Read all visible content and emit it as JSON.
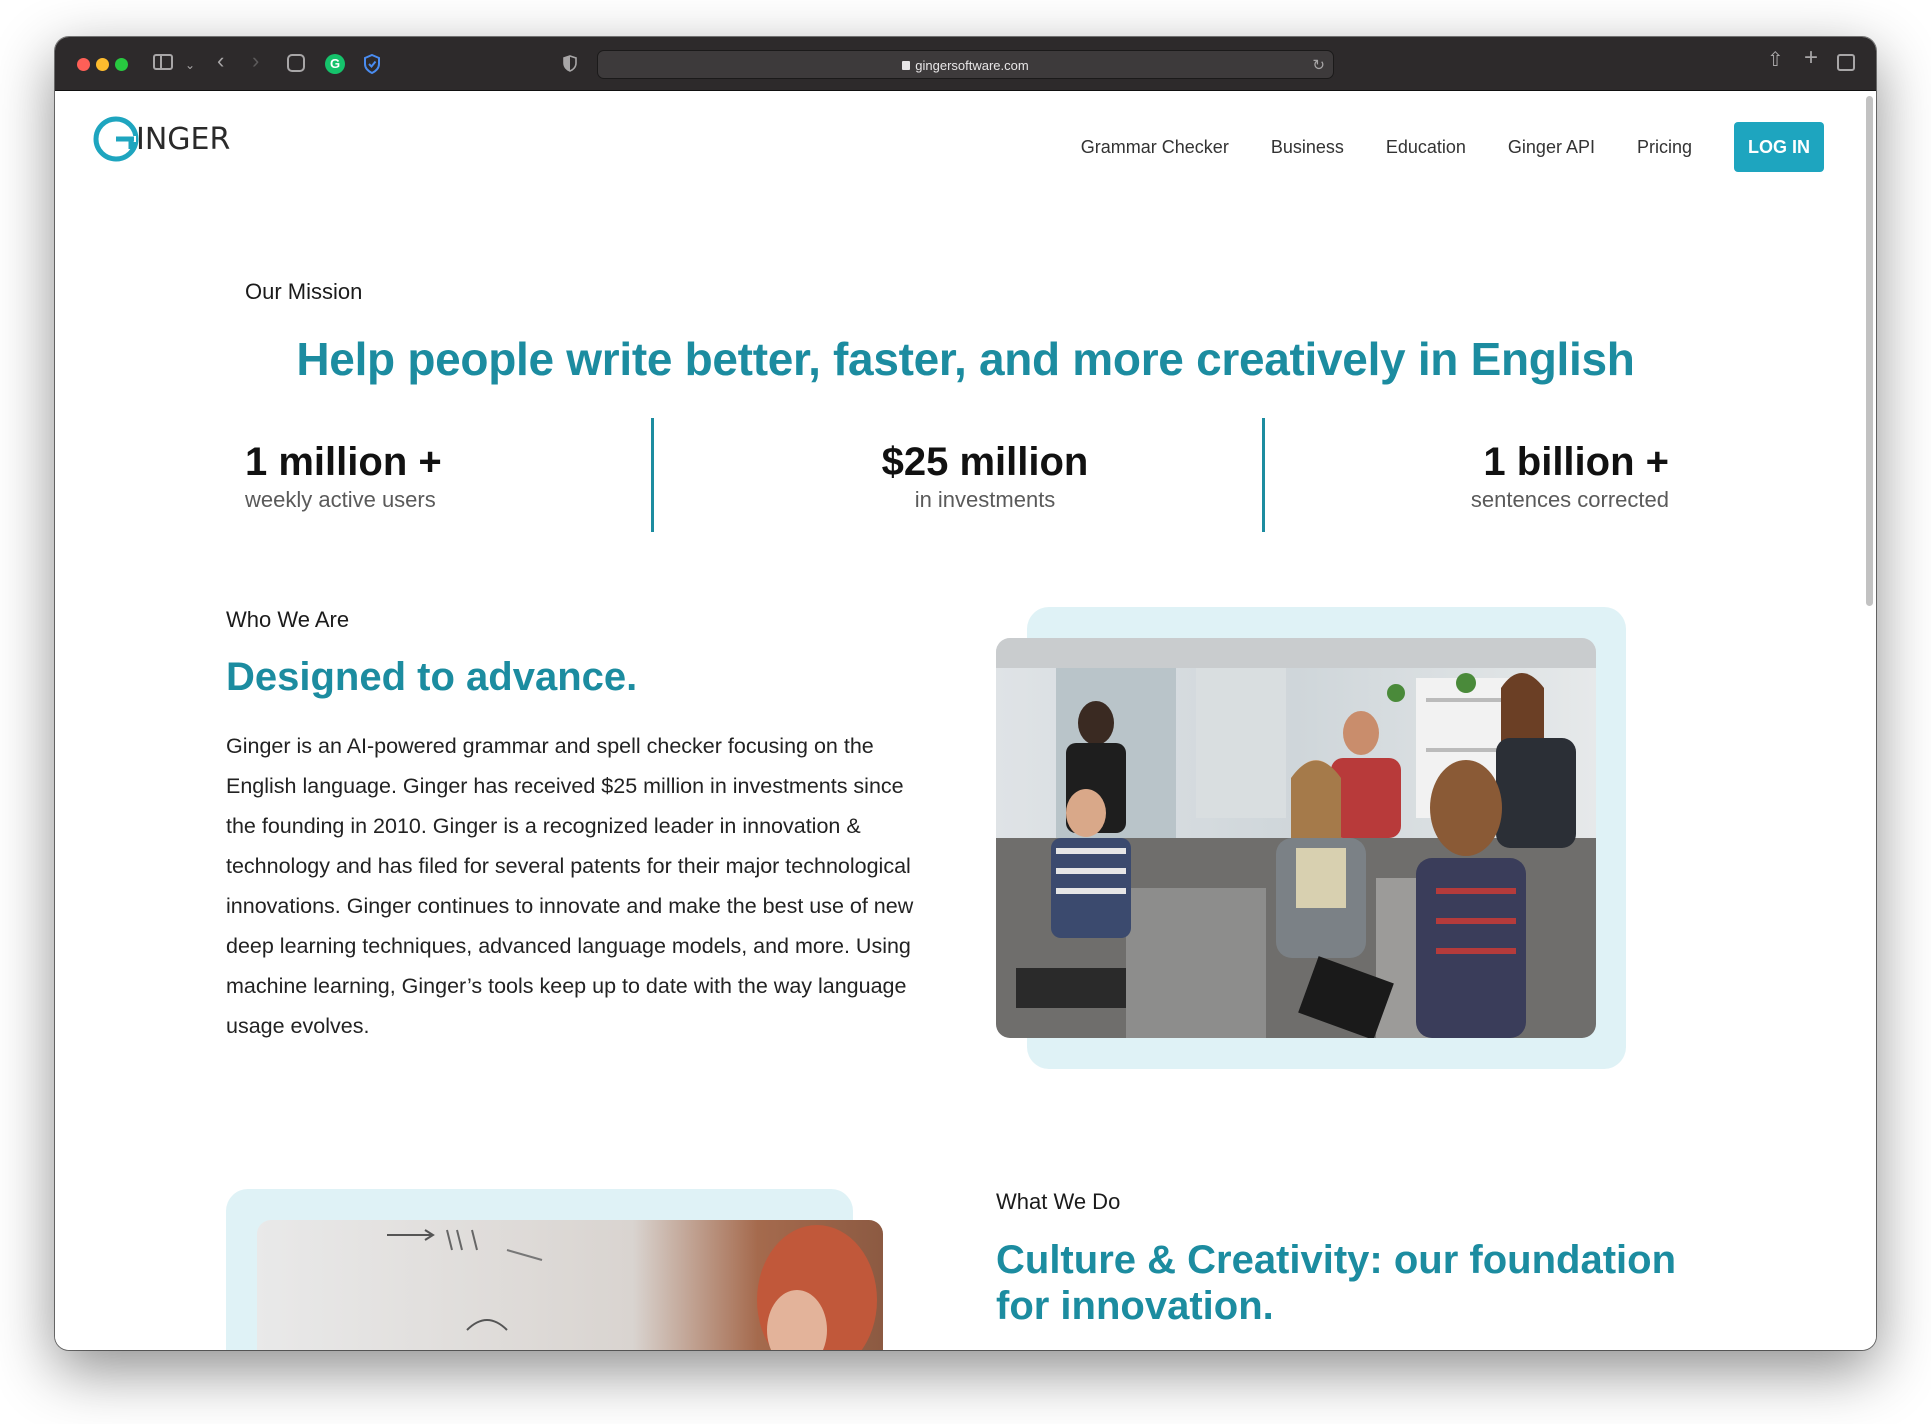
{
  "browser": {
    "url": "gingersoftware.com"
  },
  "site": {
    "logo_text": "INGER",
    "logo_letter": "G",
    "nav": [
      {
        "label": "Grammar Checker"
      },
      {
        "label": "Business"
      },
      {
        "label": "Education"
      },
      {
        "label": "Ginger API"
      },
      {
        "label": "Pricing"
      }
    ],
    "login_label": "LOG IN"
  },
  "mission": {
    "label": "Our Mission",
    "headline": "Help people write better, faster, and more creatively in English",
    "stats": [
      {
        "value": "1 million +",
        "label": "weekly active users"
      },
      {
        "value": "$25 million",
        "label": "in investments"
      },
      {
        "value": "1 billion +",
        "label": "sentences corrected"
      }
    ]
  },
  "who": {
    "label": "Who We Are",
    "title": "Designed to advance.",
    "body": "Ginger is an AI-powered grammar and spell checker focusing on the English language. Ginger has received $25 million in investments since the founding in 2010. Ginger is a recognized leader in innovation & technology and has filed for several patents for their major technological innovations. Ginger continues to innovate and make the best use of new deep learning techniques, advanced language models, and more. Using machine learning, Ginger’s tools keep up to date with the way language usage evolves."
  },
  "what": {
    "label": "What We Do",
    "title": "Culture & Creativity: our foundation for innovation."
  },
  "colors": {
    "accent": "#1c8ca0",
    "button": "#1ea5bf",
    "frame": "#dff2f6"
  }
}
